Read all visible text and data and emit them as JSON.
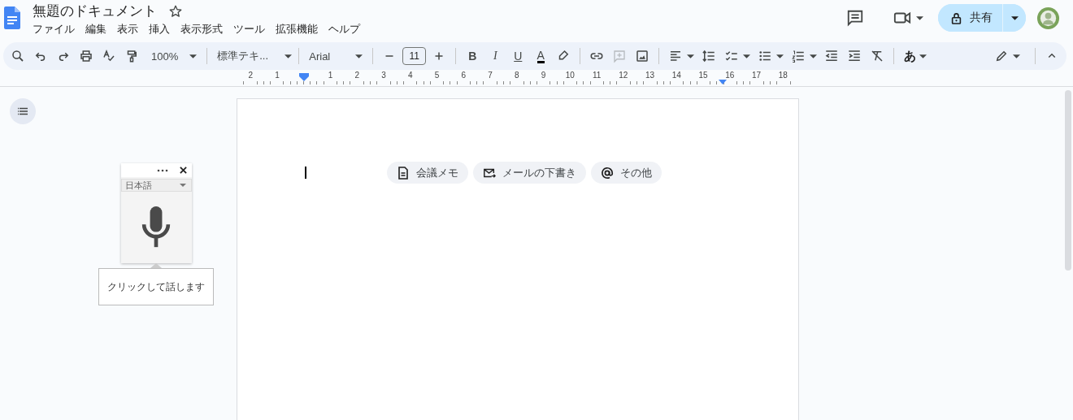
{
  "document": {
    "title": "無題のドキュメント",
    "starred": false
  },
  "menu": [
    "ファイル",
    "編集",
    "表示",
    "挿入",
    "表示形式",
    "ツール",
    "拡張機能",
    "ヘルプ"
  ],
  "share": {
    "label": "共有"
  },
  "toolbar": {
    "zoom": "100%",
    "style": "標準テキ...",
    "font": "Arial",
    "font_size": "11",
    "insert_comment": {
      "disabled": true
    },
    "input_tool": "あ",
    "format_buttons": [
      {
        "label": "B",
        "kind": "bold"
      },
      {
        "label": "I",
        "kind": "italic"
      },
      {
        "label": "U",
        "kind": "underline"
      },
      {
        "label": "A",
        "kind": "text-color"
      }
    ]
  },
  "ruler": {
    "left_labels": [
      "2",
      "1"
    ],
    "right_labels": [
      "1",
      "2",
      "3",
      "4",
      "5",
      "6",
      "7",
      "8",
      "9",
      "10",
      "11",
      "12",
      "13",
      "14",
      "15",
      "16",
      "17",
      "18"
    ]
  },
  "voice_typing": {
    "language": "日本語",
    "tooltip": "クリックして話します"
  },
  "chips": [
    {
      "label": "会議メモ",
      "kind": "meeting-notes"
    },
    {
      "label": "メールの下書き",
      "kind": "email-draft"
    },
    {
      "label": "その他",
      "kind": "more"
    }
  ]
}
